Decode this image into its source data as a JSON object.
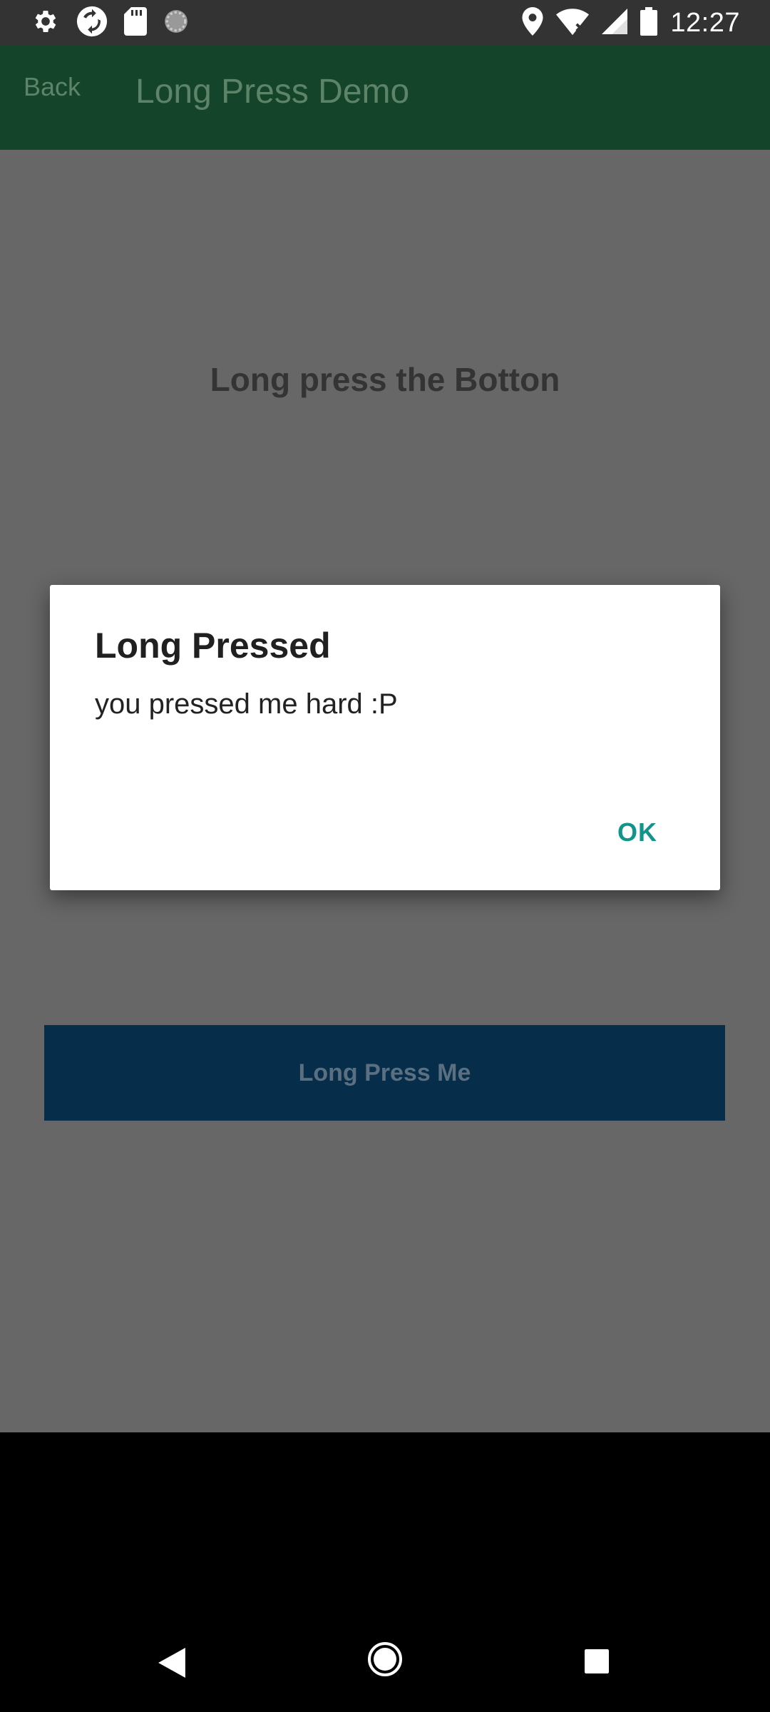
{
  "status_bar": {
    "time": "12:27",
    "left_icons": [
      "settings-icon",
      "sync-icon",
      "sd-card-icon",
      "loading-icon"
    ],
    "right_icons": [
      "location-icon",
      "wifi-icon",
      "signal-icon",
      "battery-icon"
    ]
  },
  "app_bar": {
    "back_label": "Back",
    "title": "Long Press Demo"
  },
  "main": {
    "heading": "Long press the Botton",
    "button_label": "Long Press Me"
  },
  "dialog": {
    "title": "Long Pressed",
    "message": "you pressed me hard :P",
    "ok_label": "OK"
  },
  "nav_bar": {
    "icons": [
      "back-icon",
      "home-icon",
      "recents-icon"
    ]
  },
  "colors": {
    "app_bar": "#14452a",
    "button": "#062d4a",
    "accent": "#11958a"
  }
}
